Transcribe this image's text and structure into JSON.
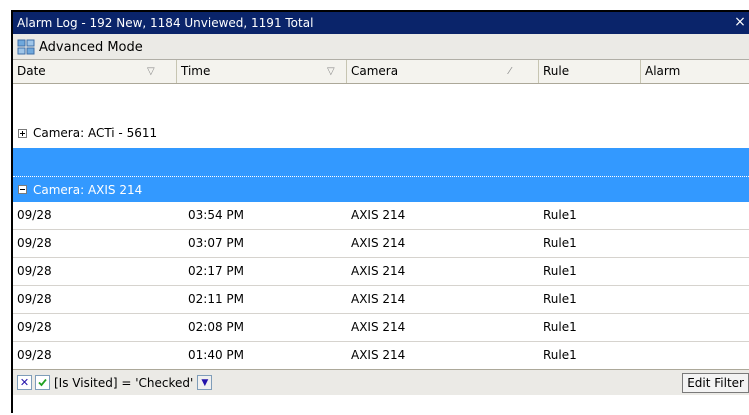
{
  "window": {
    "title": "Alarm Log - 192 New, 1184 Unviewed, 1191 Total",
    "close_glyph": "×"
  },
  "toolbar": {
    "advanced_mode_label": "Advanced Mode",
    "advanced_icon": "advanced-mode-icon"
  },
  "columns": [
    {
      "label": "Date",
      "sort": "▽"
    },
    {
      "label": "Time",
      "sort": "▽"
    },
    {
      "label": "Camera",
      "sort": "⁄"
    },
    {
      "label": "Rule",
      "sort": ""
    },
    {
      "label": "Alarm",
      "sort": ""
    }
  ],
  "groups": [
    {
      "label": "Camera: ACTi - 5611",
      "expanded": false
    },
    {
      "label": "Camera: AXIS 214",
      "expanded": true
    }
  ],
  "rows": [
    {
      "date": "09/28",
      "time": "03:54 PM",
      "camera": "AXIS 214",
      "rule": "Rule1"
    },
    {
      "date": "09/28",
      "time": "03:07 PM",
      "camera": "AXIS 214",
      "rule": "Rule1"
    },
    {
      "date": "09/28",
      "time": "02:17 PM",
      "camera": "AXIS 214",
      "rule": "Rule1"
    },
    {
      "date": "09/28",
      "time": "02:11 PM",
      "camera": "AXIS 214",
      "rule": "Rule1"
    },
    {
      "date": "09/28",
      "time": "02:08 PM",
      "camera": "AXIS 214",
      "rule": "Rule1"
    },
    {
      "date": "09/28",
      "time": "01:40 PM",
      "camera": "AXIS 214",
      "rule": "Rule1"
    }
  ],
  "filter": {
    "close_glyph": "✕",
    "expression": "[Is Visited] = 'Checked'",
    "checked": true,
    "edit_label": "Edit Filter"
  },
  "colors": {
    "title_bg": "#0a246a",
    "selection": "#3399ff",
    "toolbar_bg": "#ebeae6"
  }
}
